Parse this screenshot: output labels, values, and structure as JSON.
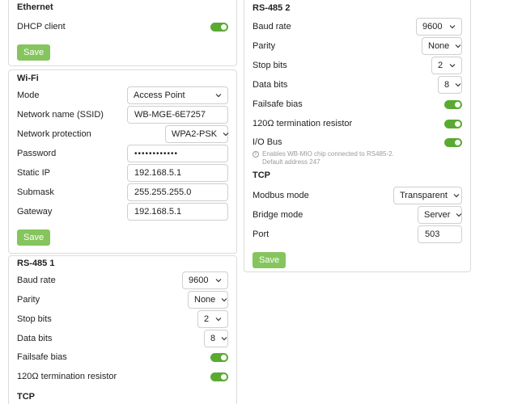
{
  "ethernet": {
    "title": "Ethernet",
    "dhcp_label": "DHCP client",
    "dhcp_on": true,
    "save": "Save"
  },
  "wifi": {
    "title": "Wi-Fi",
    "mode_label": "Mode",
    "mode_value": "Access Point",
    "ssid_label": "Network name (SSID)",
    "ssid_value": "WB-MGE-6E7257",
    "protection_label": "Network protection",
    "protection_value": "WPA2-PSK",
    "password_label": "Password",
    "password_value": "••••••••••••",
    "static_ip_label": "Static IP",
    "static_ip_value": "192.168.5.1",
    "submask_label": "Submask",
    "submask_value": "255.255.255.0",
    "gateway_label": "Gateway",
    "gateway_value": "192.168.5.1",
    "save": "Save"
  },
  "rs485_1": {
    "title": "RS-485 1",
    "baud_label": "Baud rate",
    "baud_value": "9600",
    "parity_label": "Parity",
    "parity_value": "None",
    "stop_label": "Stop bits",
    "stop_value": "2",
    "data_label": "Data bits",
    "data_value": "8",
    "failsafe_label": "Failsafe bias",
    "termination_label": "120Ω termination resistor",
    "tcp_title": "TCP"
  },
  "rs485_2": {
    "title": "RS-485 2",
    "baud_label": "Baud rate",
    "baud_value": "9600",
    "parity_label": "Parity",
    "parity_value": "None",
    "stop_label": "Stop bits",
    "stop_value": "2",
    "data_label": "Data bits",
    "data_value": "8",
    "failsafe_label": "Failsafe bias",
    "termination_label": "120Ω termination resistor",
    "iobus_label": "I/O Bus",
    "iobus_hint_line1": "Enables WB-MIO chip connected to RS485-2.",
    "iobus_hint_line2": "Default address 247",
    "tcp_title": "TCP",
    "modbus_label": "Modbus mode",
    "modbus_value": "Transparent",
    "bridge_label": "Bridge mode",
    "bridge_value": "Server",
    "port_label": "Port",
    "port_value": "503",
    "save": "Save"
  },
  "colors": {
    "toggle_on": "#5aaa32",
    "save_button": "#86c55d",
    "border": "#dcdcdc"
  },
  "icons": {
    "select_arrow": "chevron-down-icon",
    "hint": "info-icon"
  }
}
